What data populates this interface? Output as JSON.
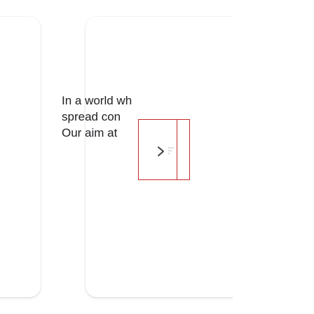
{
  "card": {
    "lines": [
      "In a world wh",
      "spread con",
      "Our aim at"
    ]
  },
  "next_button": {
    "icon": "chevron-right-icon"
  },
  "colors": {
    "focus_outline": "#c62828",
    "text": "#202124",
    "chevron": "#3c4043"
  }
}
